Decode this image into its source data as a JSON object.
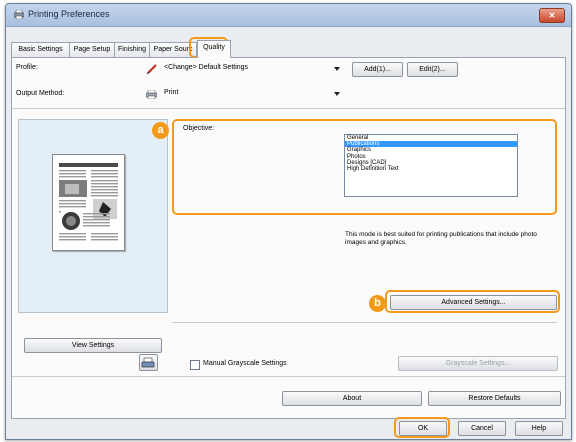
{
  "window": {
    "title": "Printing Preferences"
  },
  "tabs": [
    {
      "label": "Basic Settings",
      "active": false
    },
    {
      "label": "Page Setup",
      "active": false
    },
    {
      "label": "Finishing",
      "active": false
    },
    {
      "label": "Paper Sourc",
      "active": false
    },
    {
      "label": "Quality",
      "active": true
    }
  ],
  "profile": {
    "label": "Profile:",
    "value": "<Change> Default Settings",
    "add_label": "Add(1)...",
    "edit_label": "Edit(2)..."
  },
  "output": {
    "label": "Output Method:",
    "value": "Print"
  },
  "objective": {
    "label": "Objective:",
    "items": [
      "General",
      "Publications",
      "Graphics",
      "Photos",
      "Designs [CAD]",
      "High Definition Text"
    ],
    "selected": "Publications",
    "description": "This mode is best suited for printing publications that include photo images and graphics."
  },
  "markers": {
    "a": "a",
    "b": "b"
  },
  "buttons": {
    "advanced": "Advanced Settings...",
    "view_settings": "View Settings",
    "grayscale_settings": "Grayscale Settings...",
    "about": "About",
    "restore": "Restore Defaults",
    "ok": "OK",
    "cancel": "Cancel",
    "help": "Help"
  },
  "manual_grayscale": {
    "label": "Manual Grayscale Settings",
    "checked": false
  },
  "colors": {
    "highlight": "#f39a1b",
    "selection": "#3399ff"
  }
}
